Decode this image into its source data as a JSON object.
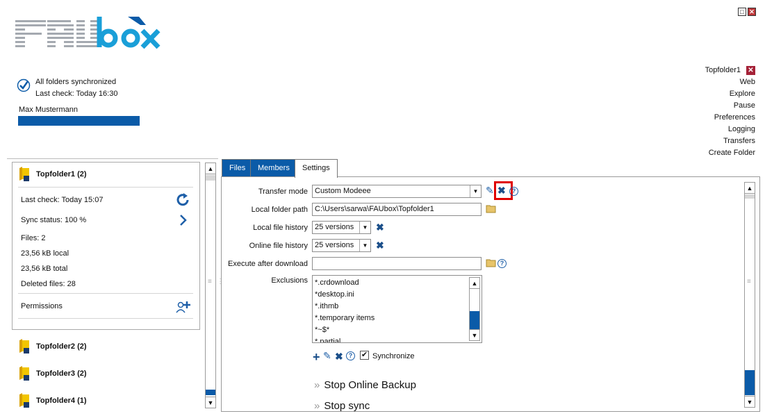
{
  "window": {
    "maximize_icon": "maximize-icon",
    "close_icon": "close-icon"
  },
  "logo": {
    "text_fau": "FAU",
    "text_box": "box"
  },
  "status": {
    "line1": "All folders synchronized",
    "line2": "Last check: Today 16:30",
    "user": "Max Mustermann",
    "icon": "check-circle-icon"
  },
  "right_menu": {
    "folder": "Topfolder1",
    "items": [
      "Web",
      "Explore",
      "Pause",
      "Preferences",
      "Logging",
      "Transfers",
      "Create Folder"
    ]
  },
  "left": {
    "card": {
      "title": "Topfolder1 (2)",
      "last_check": "Last check: Today 15:07",
      "sync_status": "Sync status: 100 %",
      "files": "Files: 2",
      "local": "23,56 kB local",
      "total": "23,56 kB total",
      "deleted": "Deleted files: 28",
      "permissions": "Permissions"
    },
    "folders": [
      "Topfolder2 (2)",
      "Topfolder3 (2)",
      "Topfolder4 (1)"
    ]
  },
  "tabs": [
    "Files",
    "Members",
    "Settings"
  ],
  "settings": {
    "transfer_mode_label": "Transfer mode",
    "transfer_mode_value": "Custom Modeee",
    "local_path_label": "Local folder path",
    "local_path_value": "C:\\Users\\sarwa\\FAUbox\\Topfolder1",
    "local_history_label": "Local file history",
    "local_history_value": "25 versions",
    "online_history_label": "Online file history",
    "online_history_value": "25 versions",
    "execute_label": "Execute after download",
    "execute_value": "",
    "exclusions_label": "Exclusions",
    "exclusions": [
      "*.crdownload",
      "*desktop.ini",
      "*.ithmb",
      "*.temporary items",
      "*~$*",
      "*.partial"
    ],
    "synchronize_label": "Synchronize",
    "synchronize_checked": true,
    "stop_backup": "Stop Online Backup",
    "stop_sync": "Stop sync"
  },
  "colors": {
    "accent": "#0b5ba8",
    "close": "#a52238",
    "highlight": "#e00000"
  }
}
